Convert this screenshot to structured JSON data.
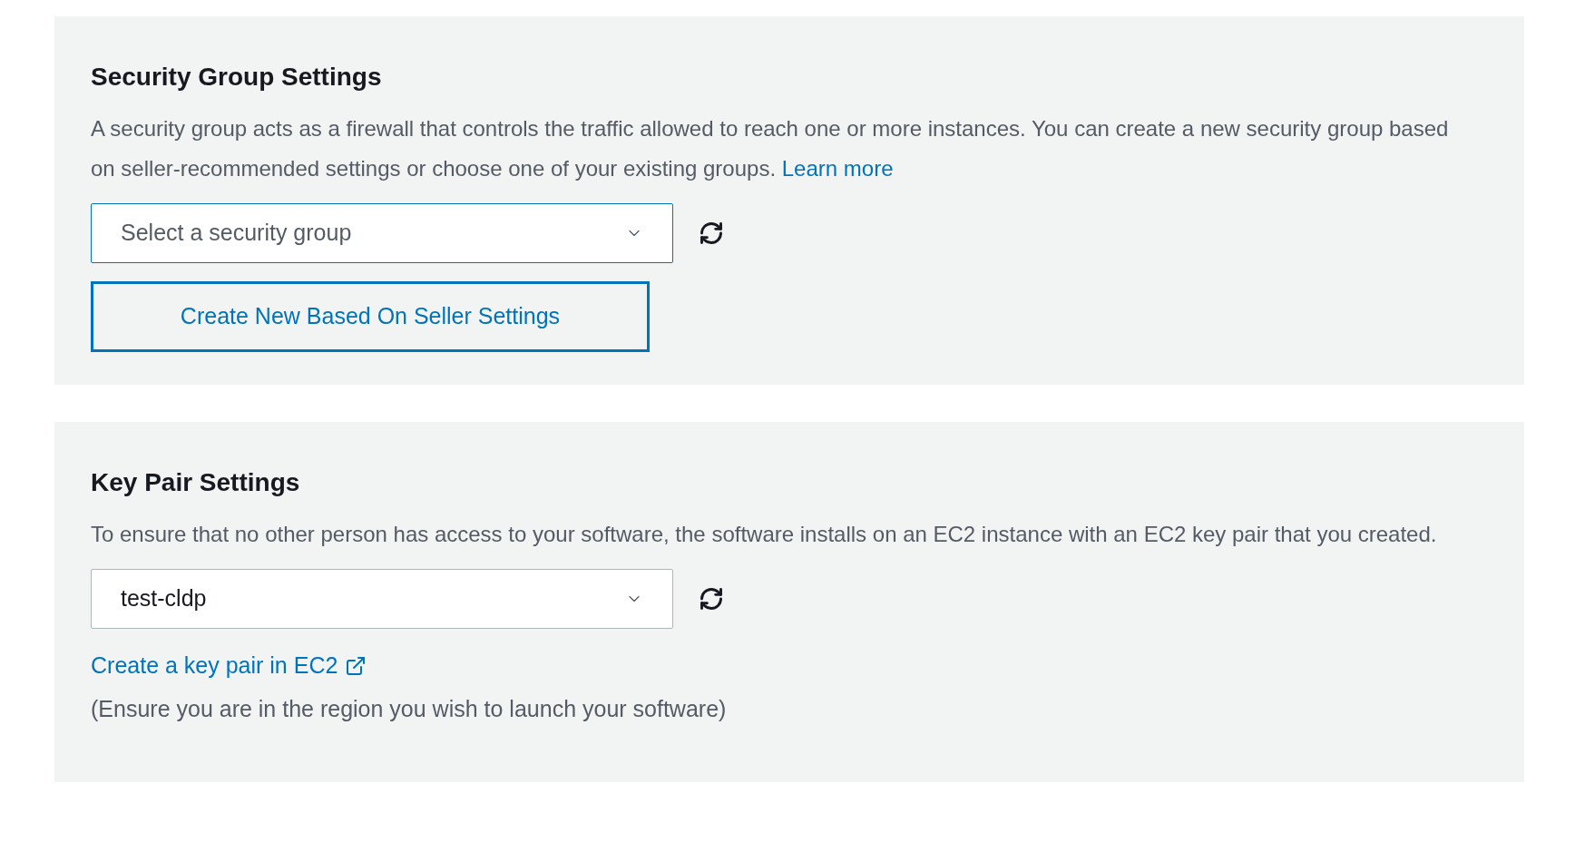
{
  "sections": [
    {
      "kind": "security_group",
      "title": "Security Group Settings",
      "description": "A security group acts as a firewall that controls the traffic allowed to reach one or more instances. You can create a new security group based on seller-recommended settings or choose one of your existing groups.",
      "link": "Learn more",
      "select": {
        "placeholder": "Select a security group",
        "focused": true
      },
      "button": "Create New Based On Seller Settings"
    },
    {
      "kind": "key_pair",
      "title": "Key Pair Settings",
      "description": "To ensure that no other person has access to your software, the software installs on an EC2 instance with an EC2 key pair that you created.",
      "select": {
        "value": "test-cldp",
        "focused": false
      },
      "link": "Create a key pair in EC2",
      "note": "(Ensure you are in the region you wish to launch your software)"
    }
  ]
}
